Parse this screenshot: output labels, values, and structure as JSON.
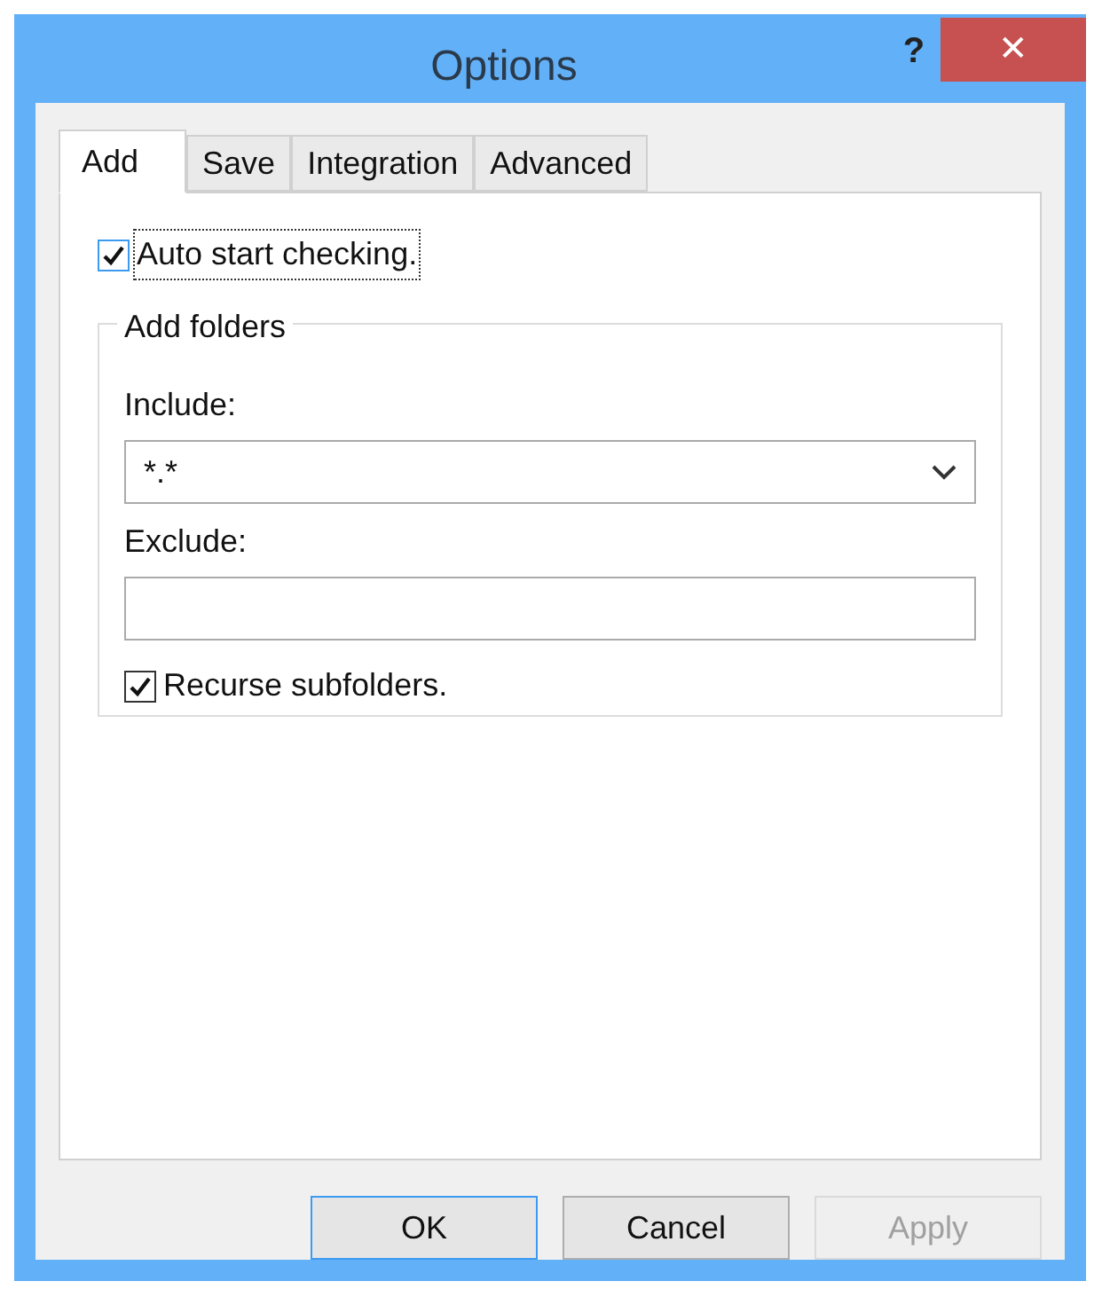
{
  "window": {
    "title": "Options",
    "help": "?",
    "close": "✕"
  },
  "tabs": [
    {
      "label": "Add",
      "selected": true
    },
    {
      "label": "Save",
      "selected": false
    },
    {
      "label": "Integration",
      "selected": false
    },
    {
      "label": "Advanced",
      "selected": false
    }
  ],
  "auto_start": {
    "label": "Auto start checking.",
    "checked": true,
    "focused": true
  },
  "group": {
    "title": "Add folders",
    "include": {
      "label": "Include:",
      "value": "*.*"
    },
    "exclude": {
      "label": "Exclude:"
    },
    "recurse": {
      "label": "Recurse subfolders.",
      "checked": true
    }
  },
  "buttons": [
    {
      "label": "OK",
      "kind": "default",
      "disabled": false
    },
    {
      "label": "Cancel",
      "kind": "normal",
      "disabled": false
    },
    {
      "label": "Apply",
      "kind": "normal",
      "disabled": true
    }
  ]
}
